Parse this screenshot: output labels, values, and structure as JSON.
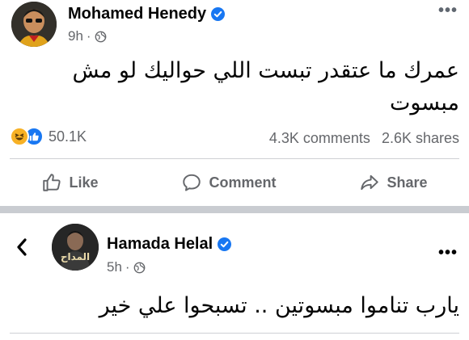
{
  "post1": {
    "author": "Mohamed Henedy",
    "time": "9h",
    "privacy_icon": "globe-icon",
    "text_line1": "عمرك ما عتقدر تبست اللي حواليك لو مش",
    "text_line2": "مبسوت",
    "reaction_count": "50.1K",
    "comments": "4.3K comments",
    "shares": "2.6K shares",
    "actions": {
      "like": "Like",
      "comment": "Comment",
      "share": "Share"
    }
  },
  "post2": {
    "author": "Hamada Helal",
    "time": "5h",
    "privacy_icon": "globe-icon",
    "text_line1": "يارب تناموا مبسوتين .. تسبحوا علي خير",
    "avatar_caption": "المداح"
  },
  "colors": {
    "verified_blue": "#1877f2",
    "secondary_text": "#65676b",
    "like_blue": "#1877f2",
    "haha_yellow": "#f7b125",
    "separator_gray": "#c9ccd1"
  }
}
